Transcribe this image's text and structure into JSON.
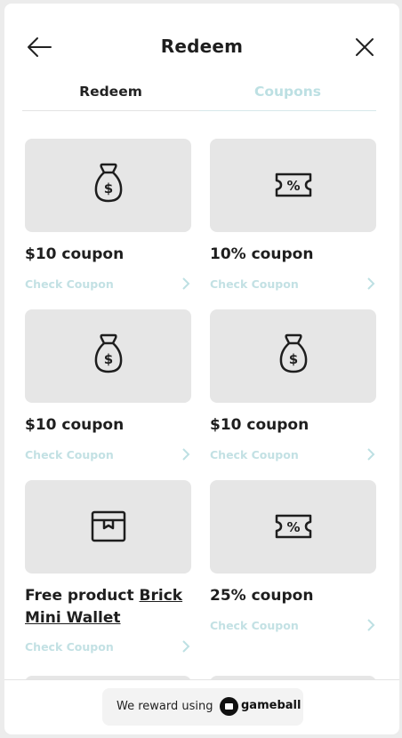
{
  "header": {
    "title": "Redeem",
    "back_icon": "arrow-left-icon",
    "close_icon": "close-icon"
  },
  "tabs": [
    {
      "label": "Redeem",
      "active": true
    },
    {
      "label": "Coupons",
      "active": false
    }
  ],
  "colors": {
    "accent_light": "#bde0e3",
    "card_bg": "#e6e6e6",
    "text": "#1e1e1e"
  },
  "cards": [
    {
      "title": "$10 coupon",
      "icon": "money-bag-icon",
      "link": "Check Coupon"
    },
    {
      "title": "10% coupon",
      "icon": "percent-ticket-icon",
      "link": "Check Coupon"
    },
    {
      "title": "$10 coupon",
      "icon": "money-bag-icon",
      "link": "Check Coupon"
    },
    {
      "title": "$10 coupon",
      "icon": "money-bag-icon",
      "link": "Check Coupon"
    },
    {
      "title_prefix": "Free product",
      "title_link": "Brick Mini Wallet",
      "icon": "box-icon",
      "link": "Check Coupon"
    },
    {
      "title": "25% coupon",
      "icon": "percent-ticket-icon",
      "link": "Check Coupon"
    }
  ],
  "footer": {
    "text": "We reward using",
    "brand": "gameball"
  }
}
